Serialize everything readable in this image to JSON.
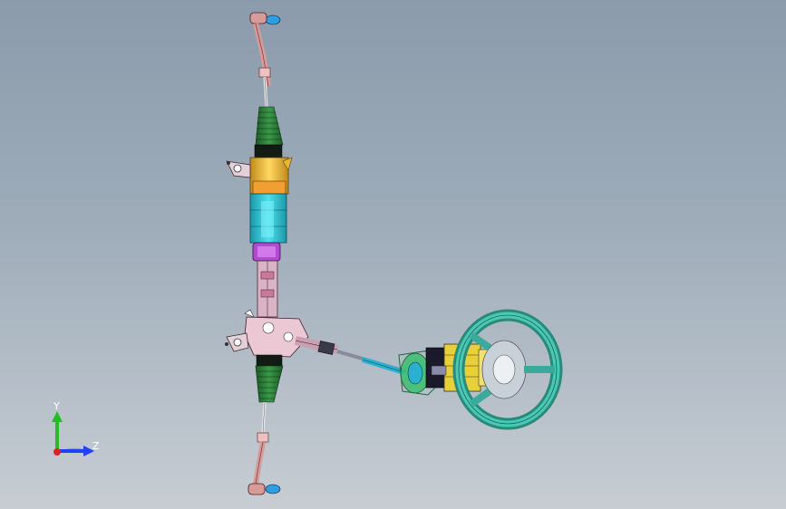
{
  "viewport": {
    "background_top": "#8b9bab",
    "background_bottom": "#c7cdd3"
  },
  "model": {
    "rack_colors": {
      "boot": "#2f7a3a",
      "gear_housing": "#e8b830",
      "motor": "#2ec8d8",
      "motor_cap": "#b04ad0",
      "tie_rod": "#d99a9a",
      "outer_end": "#2aa0e0"
    },
    "column_colors": {
      "shaft": "#c9a0b0",
      "intermediate": "#3aa0c0",
      "yoke": "#3ac070",
      "module": "#e8d03a",
      "wheel": "#3aaa9a"
    }
  },
  "triad": {
    "y_label": "Y",
    "z_label": "Z",
    "y_color": "#20c020",
    "z_color": "#2040ff",
    "origin_color": "#e02020"
  }
}
